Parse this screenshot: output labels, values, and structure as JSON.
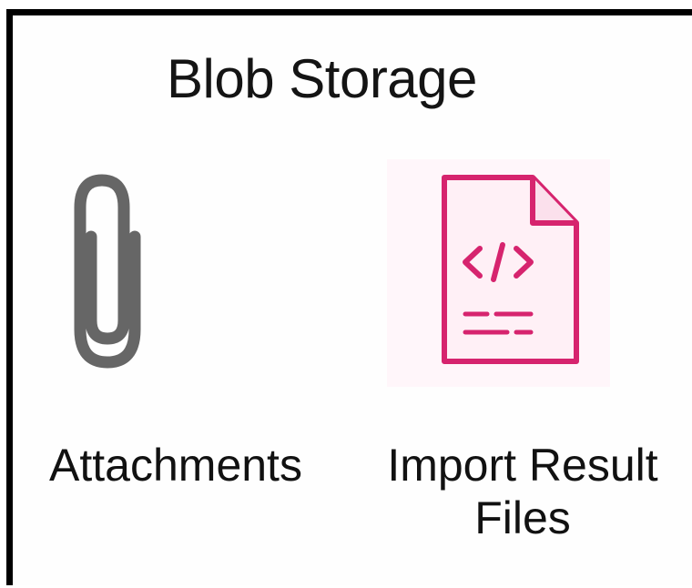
{
  "panel": {
    "title": "Blob Storage"
  },
  "items": [
    {
      "label": "Attachments",
      "icon": "paperclip-icon",
      "color": "#666666"
    },
    {
      "label_line1": "Import Result",
      "label_line2": "Files",
      "icon": "code-file-icon",
      "color": "#D6246E"
    }
  ]
}
